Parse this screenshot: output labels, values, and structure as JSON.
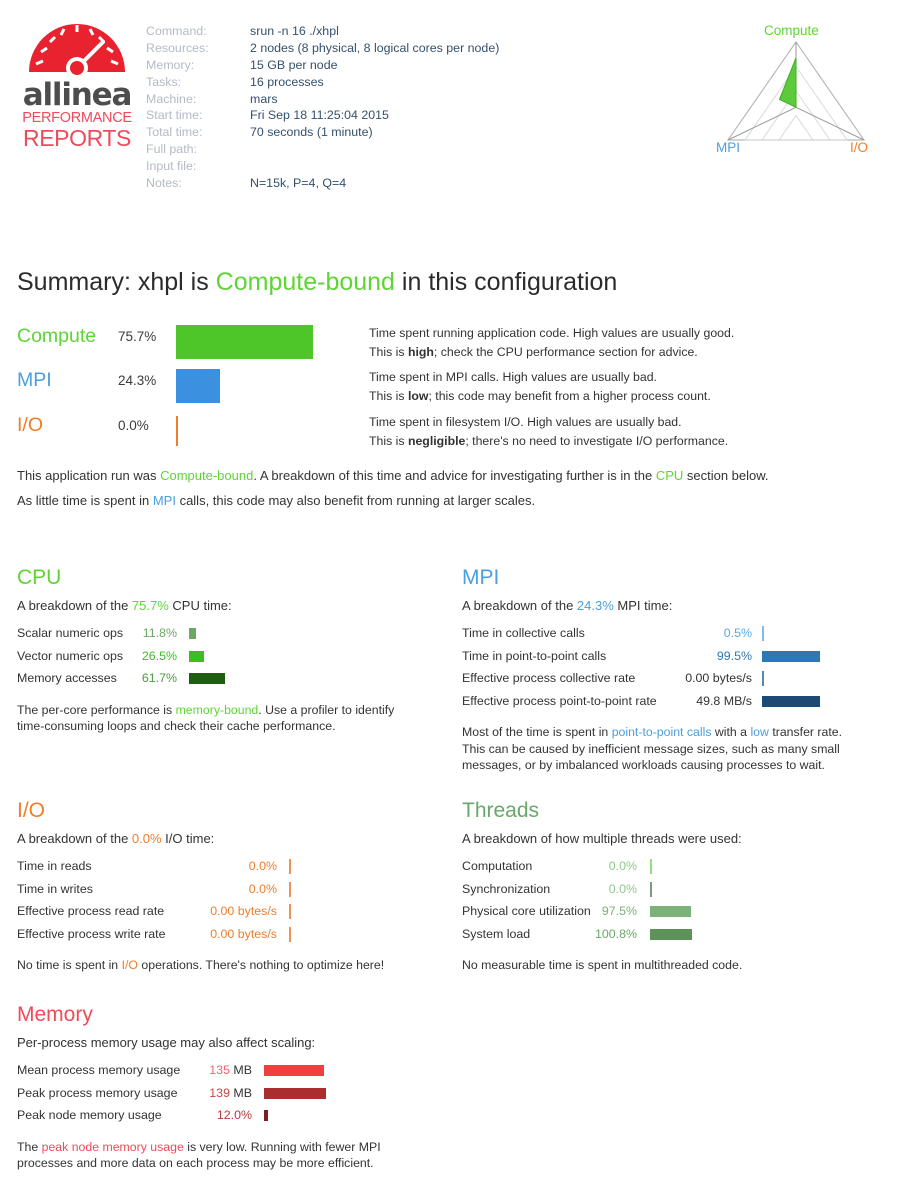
{
  "logo": {
    "brand": "allinea",
    "line2": "PERFORMANCE",
    "line3": "REPORTS",
    "gauge_color": "#e8232f",
    "brand_color": "#4d4d4d",
    "sub_color": "#ef4b5a"
  },
  "header": {
    "rows": [
      {
        "label": "Command:",
        "value": "srun -n 16 ./xhpl"
      },
      {
        "label": "Resources:",
        "value": "2 nodes (8 physical, 8 logical cores per node)"
      },
      {
        "label": "Memory:",
        "value": "15 GB per node"
      },
      {
        "label": "Tasks:",
        "value": "16 processes"
      },
      {
        "label": "Machine:",
        "value": "mars"
      },
      {
        "label": "Start time:",
        "value": "Fri Sep 18 11:25:04 2015"
      },
      {
        "label": "Total time:",
        "value": "70 seconds (1 minute)"
      },
      {
        "label": "Full path:",
        "value": ""
      },
      {
        "label": "Input file:",
        "value": ""
      },
      {
        "label": "Notes:",
        "value": "N=15k, P=4, Q=4"
      }
    ]
  },
  "radar": {
    "axes": [
      "Compute",
      "MPI",
      "I/O"
    ],
    "values": [
      75.7,
      24.3,
      0.0
    ],
    "colors": {
      "compute": "#5fd535",
      "mpi": "#4a9fe0",
      "io": "#f07d28"
    }
  },
  "summary": {
    "title_prefix": "Summary: xhpl is ",
    "title_highlight": "Compute-bound",
    "title_suffix": " in this configuration",
    "rows": [
      {
        "name": "Compute",
        "pct": "75.7%",
        "value": 75.7,
        "color": "#4ec62a",
        "desc_line1": "Time spent running application code. High values are usually good.",
        "desc_line2_pre": "This is ",
        "desc_line2_bold": "high",
        "desc_line2_post": "; check the CPU performance section for advice."
      },
      {
        "name": "MPI",
        "pct": "24.3%",
        "value": 24.3,
        "color": "#3b90e0",
        "desc_line1": "Time spent in MPI calls. High values are usually bad.",
        "desc_line2_pre": "This is ",
        "desc_line2_bold": "low",
        "desc_line2_post": "; this code may benefit from a higher process count."
      },
      {
        "name": "I/O",
        "pct": "0.0%",
        "value": 0.0,
        "color": "#f07d28",
        "desc_line1": "Time spent in filesystem I/O. High values are usually bad.",
        "desc_line2_pre": "This is ",
        "desc_line2_bold": "negligible",
        "desc_line2_post": "; there's no need to investigate I/O performance."
      }
    ],
    "para1_a": "This application run was ",
    "para1_b": "Compute-bound",
    "para1_c": ". A breakdown of this time and advice for investigating further is in the ",
    "para1_d": "CPU",
    "para1_e": " section below.",
    "para2_a": "As little time is spent in ",
    "para2_b": "MPI",
    "para2_c": " calls, this code may also benefit from running at larger scales."
  },
  "cpu": {
    "title": "CPU",
    "sub_a": "A breakdown of the ",
    "sub_b": "75.7%",
    "sub_c": " CPU time:",
    "metrics": [
      {
        "label": "Scalar numeric ops",
        "value": "11.8%",
        "pct": 11.8,
        "color": "#6aa863",
        "vcolor": "#6aa863"
      },
      {
        "label": "Vector numeric ops",
        "value": "26.5%",
        "pct": 26.5,
        "color": "#3cbd21",
        "vcolor": "#3cbd21"
      },
      {
        "label": "Memory accesses",
        "value": "61.7%",
        "pct": 61.7,
        "color": "#1f5e12",
        "vcolor": "#4d9b3f"
      }
    ],
    "note_a": "The per-core performance is ",
    "note_b": "memory-bound",
    "note_c": ". Use a profiler to identify",
    "note_d": "time-consuming loops and check their cache performance."
  },
  "mpi": {
    "title": "MPI",
    "sub_a": "A breakdown of the ",
    "sub_b": "24.3%",
    "sub_c": " MPI time:",
    "metrics": [
      {
        "label": "Time in collective calls",
        "value": "0.5%",
        "pct": 0.5,
        "color": "#7ebbe8",
        "vcolor": "#5aa8e0"
      },
      {
        "label": "Time in point-to-point calls",
        "value": "99.5%",
        "pct": 99.5,
        "color": "#2e79b5",
        "vcolor": "#2e79b5"
      },
      {
        "label": "Effective process collective rate",
        "value": "0.00 bytes/s",
        "pct": 0.5,
        "color": "#5588ac",
        "vcolor": "#333333"
      },
      {
        "label": "Effective process point-to-point rate",
        "value": "49.8 MB/s",
        "pct": 99.5,
        "color": "#1c4a74",
        "vcolor": "#333333"
      }
    ],
    "note_a": "Most of the time is spent in ",
    "note_b": "point-to-point calls",
    "note_c": " with a ",
    "note_d": "low",
    "note_e": " transfer rate.",
    "note_f": "This can be caused by inefficient message sizes, such as many small",
    "note_g": "messages, or by imbalanced workloads causing processes to wait."
  },
  "io": {
    "title": "I/O",
    "sub_a": "A breakdown of the ",
    "sub_b": "0.0%",
    "sub_c": " I/O time:",
    "metrics": [
      {
        "label": "Time in reads",
        "value": "0.0%",
        "pct": 0.0,
        "color": "#f0915a",
        "vcolor": "#f07d28"
      },
      {
        "label": "Time in writes",
        "value": "0.0%",
        "pct": 0.0,
        "color": "#f0915a",
        "vcolor": "#f07d28"
      },
      {
        "label": "Effective process read rate",
        "value": "0.00 bytes/s",
        "pct": 0.0,
        "color": "#f0915a",
        "vcolor": "#f07d28"
      },
      {
        "label": "Effective process write rate",
        "value": "0.00 bytes/s",
        "pct": 0.0,
        "color": "#f0915a",
        "vcolor": "#f07d28"
      }
    ],
    "note_a": "No time is spent in ",
    "note_b": "I/O",
    "note_c": " operations. There's nothing to optimize here!"
  },
  "threads": {
    "title": "Threads",
    "sub": "A breakdown of how multiple threads were used:",
    "metrics": [
      {
        "label": "Computation",
        "value": "0.0%",
        "pct": 0.0,
        "color": "#90de7c",
        "vcolor": "#8ec98a"
      },
      {
        "label": "Synchronization",
        "value": "0.0%",
        "pct": 0.0,
        "color": "#7a9c7a",
        "vcolor": "#8ec98a"
      },
      {
        "label": "Physical core utilization",
        "value": "97.5%",
        "pct": 97.5,
        "color": "#7cb179",
        "vcolor": "#7cb179"
      },
      {
        "label": "System load",
        "value": "100.8%",
        "pct": 100.8,
        "color": "#5d9358",
        "vcolor": "#6aa76a"
      }
    ],
    "note": "No measurable time is spent in multithreaded code."
  },
  "memory": {
    "title": "Memory",
    "sub": "Per-process memory usage may also affect scaling:",
    "metrics": [
      {
        "label": "Mean process memory usage",
        "value": "135",
        "unit": " MB",
        "pct": 97.0,
        "color": "#ef4040",
        "vcolor": "#f4636e"
      },
      {
        "label": "Peak process memory usage",
        "value": "139",
        "unit": " MB",
        "pct": 100.0,
        "color": "#aa2e2e",
        "vcolor": "#cc4444"
      },
      {
        "label": "Peak node memory usage",
        "value": "12.0%",
        "unit": "",
        "pct": 6.0,
        "color": "#7d1f1f",
        "vcolor": "#b33a3a"
      }
    ],
    "note_a": "The ",
    "note_b": "peak node memory usage",
    "note_c": " is very low. Running with fewer MPI",
    "note_d": "processes and more data on each process may be more efficient."
  }
}
